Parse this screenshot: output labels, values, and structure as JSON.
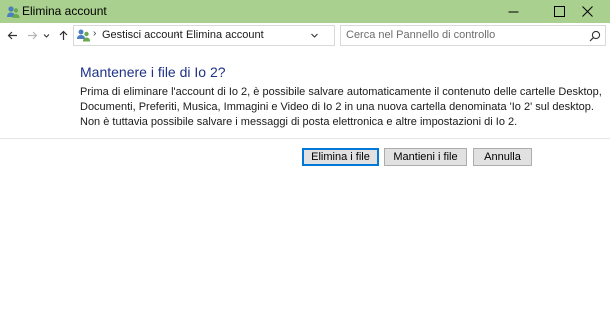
{
  "window": {
    "title": "Elimina account",
    "icon": "user-accounts-icon"
  },
  "navigation": {
    "breadcrumb": [
      "Gestisci account",
      "Elimina account"
    ],
    "search_placeholder": "Cerca nel Pannello di controllo"
  },
  "content": {
    "heading": "Mantenere i file di Io 2?",
    "body_lines": [
      "Prima di eliminare l'account di Io 2, è possibile salvare automaticamente il contenuto delle cartelle Desktop,",
      "Documenti, Preferiti, Musica, Immagini e Video di Io 2 in una nuova cartella denominata 'Io 2' sul desktop.",
      "Non è tuttavia possibile salvare i messaggi di posta elettronica e altre impostazioni di Io 2."
    ]
  },
  "buttons": {
    "delete_files": "Elimina i file",
    "keep_files": "Mantieni i file",
    "cancel": "Annulla"
  },
  "colors": {
    "titlebar": "#a9d08e",
    "heading": "#1e3287",
    "default_button_border": "#0078d7"
  }
}
